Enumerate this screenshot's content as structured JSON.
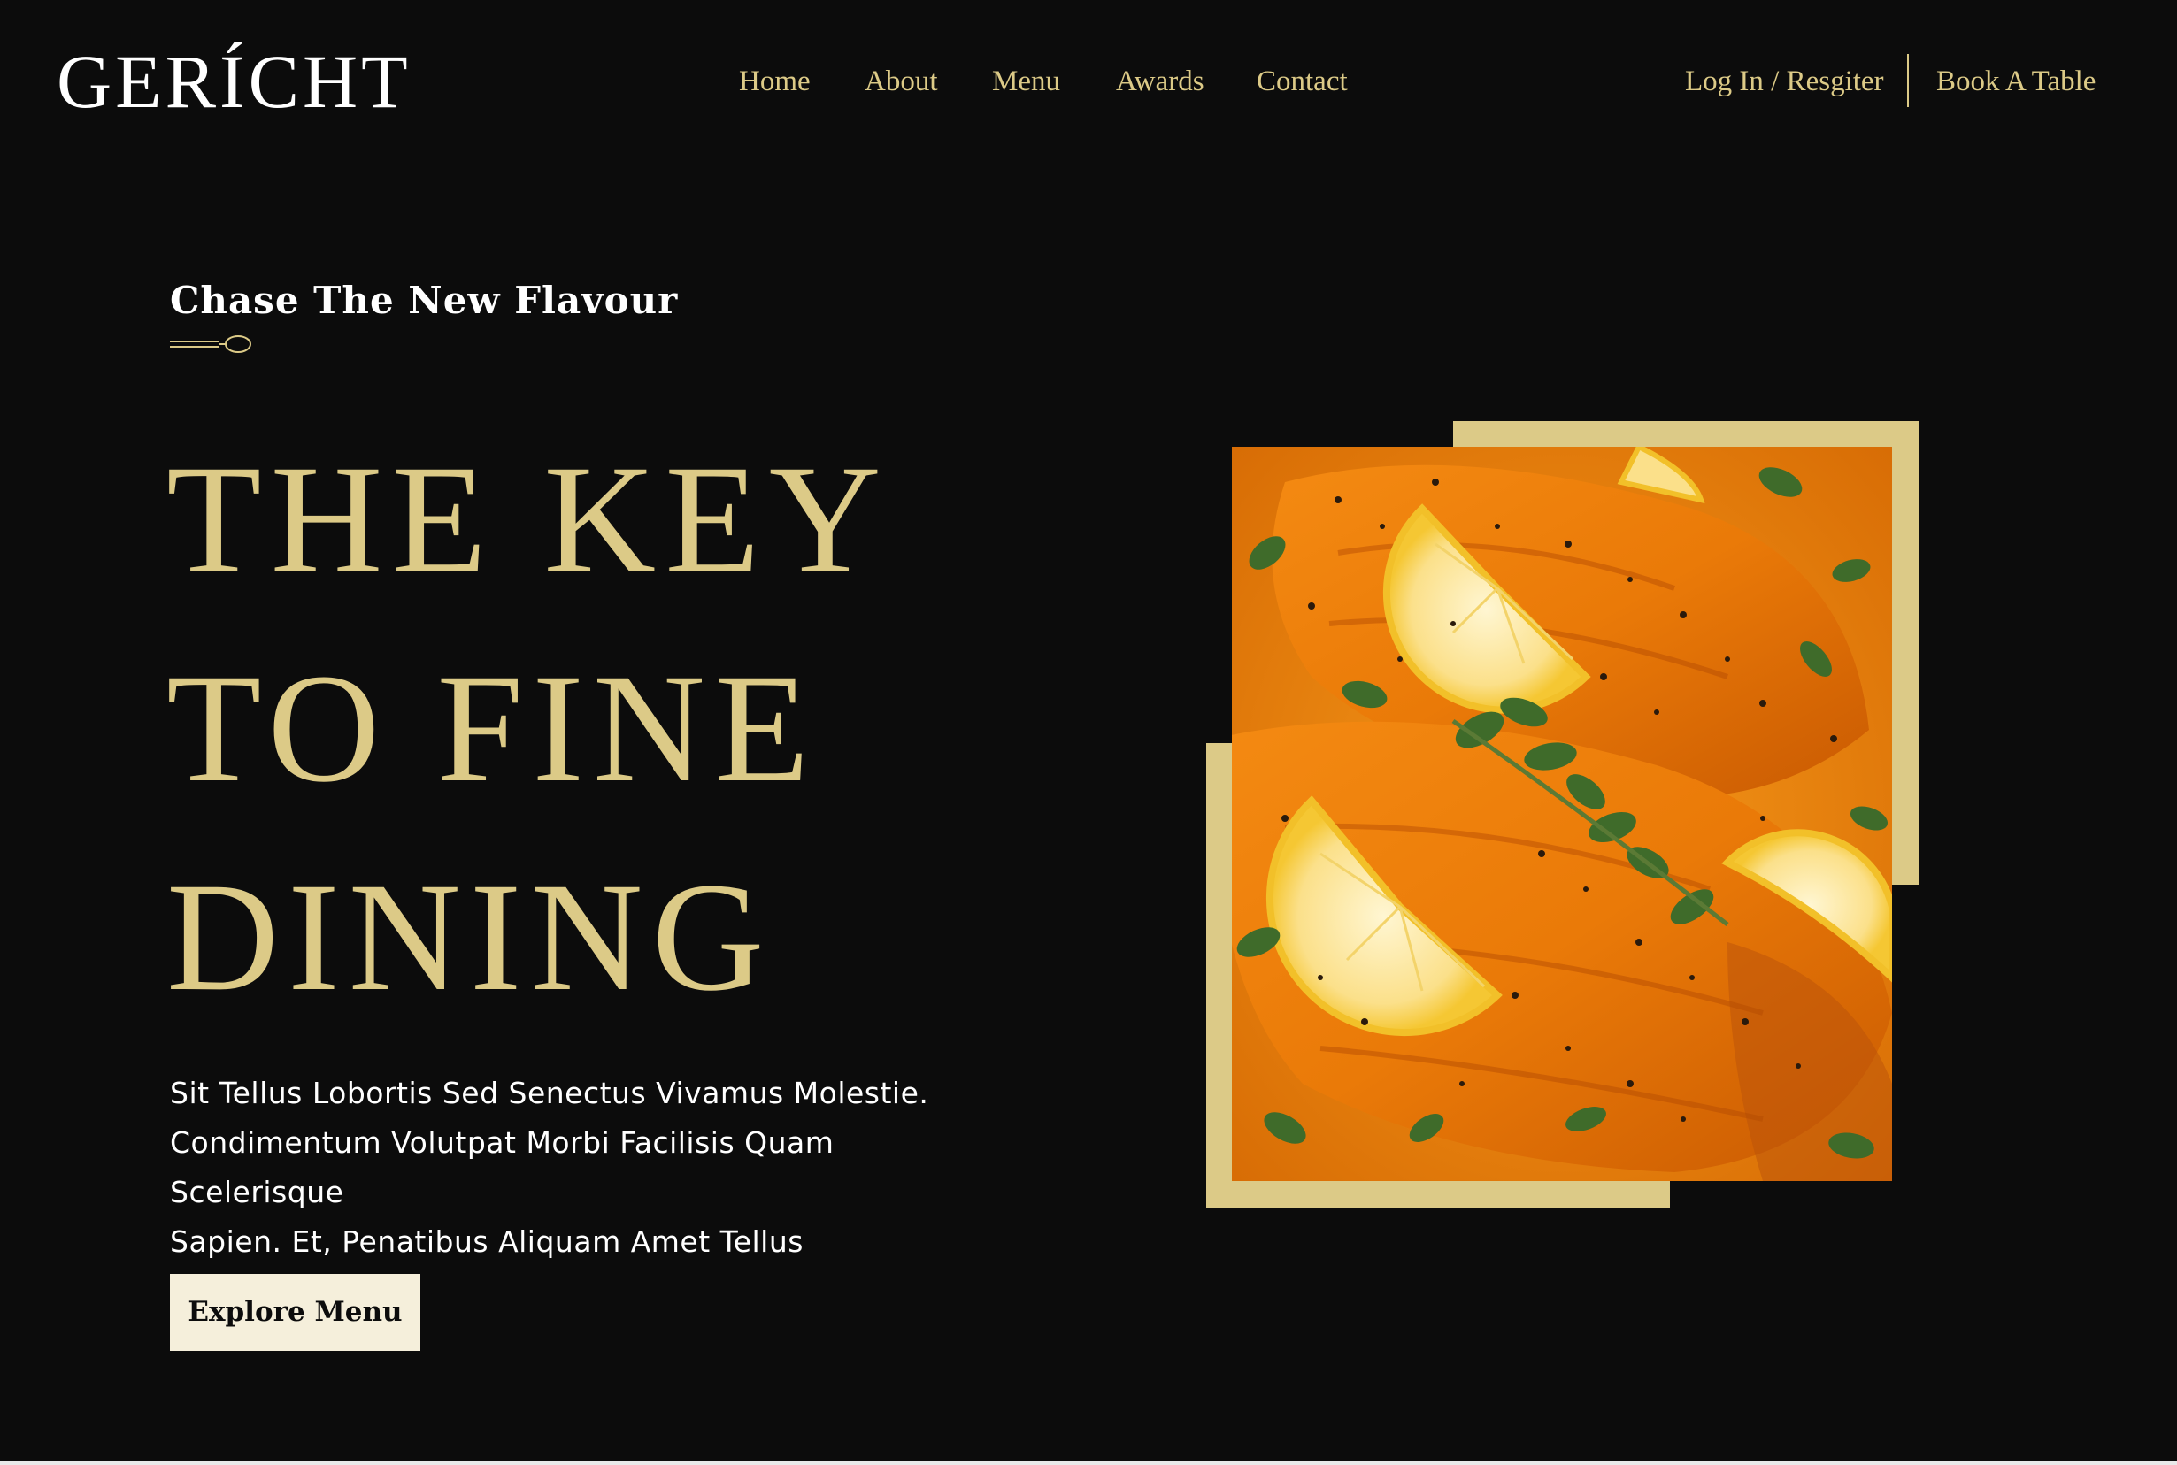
{
  "brand": {
    "logo_text": "GERÍCHT"
  },
  "nav": {
    "links": [
      "Home",
      "About",
      "Menu",
      "Awards",
      "Contact"
    ],
    "login_label": "Log In / Resgiter",
    "book_label": "Book A Table"
  },
  "hero": {
    "subtitle": "Chase The New Flavour",
    "headline_lines": [
      "THE KEY",
      "TO FINE",
      "DINING"
    ],
    "description_lines": [
      "Sit Tellus Lobortis Sed Senectus Vivamus Molestie.",
      "Condimentum Volutpat Morbi Facilisis Quam Scelerisque",
      "Sapien. Et, Penatibus Aliquam Amet Tellus"
    ],
    "cta_label": "Explore Menu"
  },
  "colors": {
    "background": "#0c0c0c",
    "accent_gold": "#dcca87",
    "button_cream": "#f5efdb",
    "text_white": "#ffffff"
  },
  "icons": {
    "divider": "spoon-icon",
    "hero_image": "salmon-dish-image"
  }
}
